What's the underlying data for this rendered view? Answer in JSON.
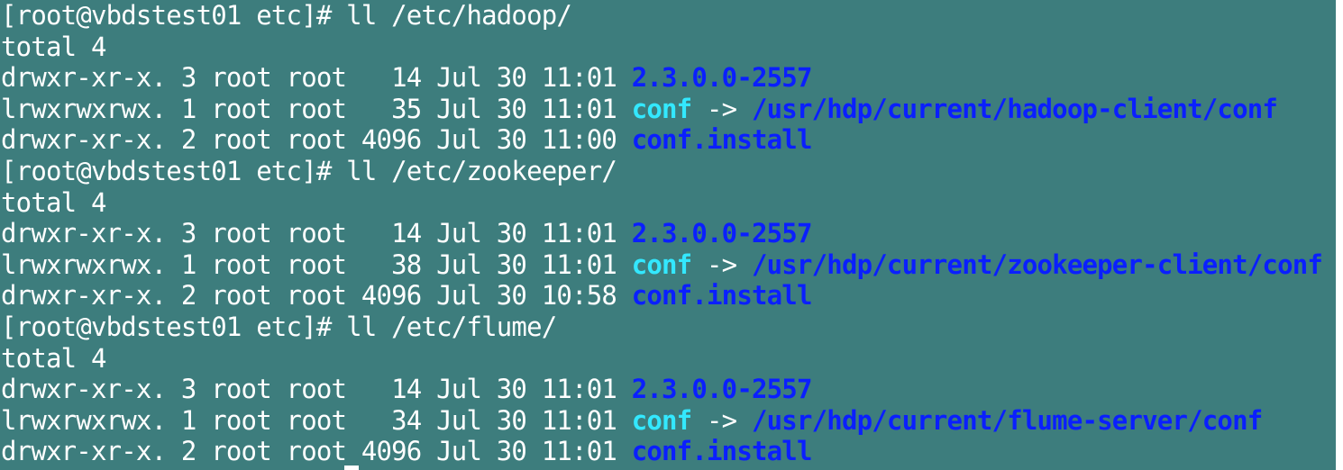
{
  "terminal": {
    "colors": {
      "background": "#3d7d7d",
      "text": "#ffffff",
      "directory": "#0a1fff",
      "symlink": "#33e8ff",
      "symlink_target": "#0a1fff"
    },
    "lines": [
      {
        "segments": [
          {
            "text": "[root@vbdstest01 etc]# ll /etc/hadoop/",
            "style": "plain"
          }
        ]
      },
      {
        "segments": [
          {
            "text": "total 4",
            "style": "plain"
          }
        ]
      },
      {
        "segments": [
          {
            "text": "drwxr-xr-x. 3 root root   14 Jul 30 11:01 ",
            "style": "plain"
          },
          {
            "text": "2.3.0.0-2557",
            "style": "dir"
          }
        ]
      },
      {
        "segments": [
          {
            "text": "lrwxrwxrwx. 1 root root   35 Jul 30 11:01 ",
            "style": "plain"
          },
          {
            "text": "conf",
            "style": "link"
          },
          {
            "text": " -> ",
            "style": "plain"
          },
          {
            "text": "/usr/hdp/current/hadoop-client/conf",
            "style": "target"
          }
        ]
      },
      {
        "segments": [
          {
            "text": "drwxr-xr-x. 2 root root 4096 Jul 30 11:00 ",
            "style": "plain"
          },
          {
            "text": "conf.install",
            "style": "dir"
          }
        ]
      },
      {
        "segments": [
          {
            "text": "[root@vbdstest01 etc]# ll /etc/zookeeper/",
            "style": "plain"
          }
        ]
      },
      {
        "segments": [
          {
            "text": "total 4",
            "style": "plain"
          }
        ]
      },
      {
        "segments": [
          {
            "text": "drwxr-xr-x. 3 root root   14 Jul 30 11:01 ",
            "style": "plain"
          },
          {
            "text": "2.3.0.0-2557",
            "style": "dir"
          }
        ]
      },
      {
        "segments": [
          {
            "text": "lrwxrwxrwx. 1 root root   38 Jul 30 11:01 ",
            "style": "plain"
          },
          {
            "text": "conf",
            "style": "link"
          },
          {
            "text": " -> ",
            "style": "plain"
          },
          {
            "text": "/usr/hdp/current/zookeeper-client/conf",
            "style": "target"
          }
        ]
      },
      {
        "segments": [
          {
            "text": "drwxr-xr-x. 2 root root 4096 Jul 30 10:58 ",
            "style": "plain"
          },
          {
            "text": "conf.install",
            "style": "dir"
          }
        ]
      },
      {
        "segments": [
          {
            "text": "[root@vbdstest01 etc]# ll /etc/flume/",
            "style": "plain"
          }
        ]
      },
      {
        "segments": [
          {
            "text": "total 4",
            "style": "plain"
          }
        ]
      },
      {
        "segments": [
          {
            "text": "drwxr-xr-x. 3 root root   14 Jul 30 11:01 ",
            "style": "plain"
          },
          {
            "text": "2.3.0.0-2557",
            "style": "dir"
          }
        ]
      },
      {
        "segments": [
          {
            "text": "lrwxrwxrwx. 1 root root   34 Jul 30 11:01 ",
            "style": "plain"
          },
          {
            "text": "conf",
            "style": "link"
          },
          {
            "text": " -> ",
            "style": "plain"
          },
          {
            "text": "/usr/hdp/current/flume-server/conf",
            "style": "target"
          }
        ]
      },
      {
        "segments": [
          {
            "text": "drwxr-xr-x. 2 root root 4096 Jul 30 11:01 ",
            "style": "plain"
          },
          {
            "text": "conf.install",
            "style": "dir"
          }
        ]
      }
    ]
  }
}
